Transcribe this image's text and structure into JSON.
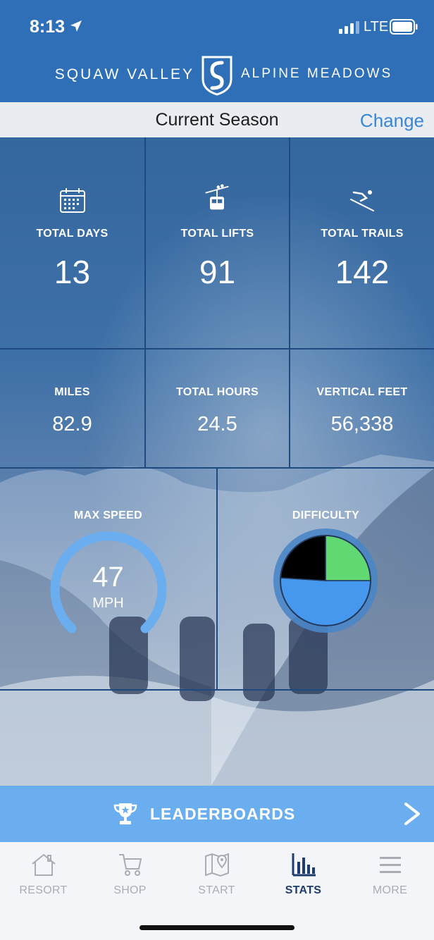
{
  "status_bar": {
    "time": "8:13",
    "network": "LTE"
  },
  "brand": {
    "left": "SQUAW VALLEY",
    "right": "ALPINE MEADOWS"
  },
  "season": {
    "title": "Current Season",
    "change_label": "Change"
  },
  "stats": {
    "total_days": {
      "label": "TOTAL DAYS",
      "value": "13",
      "icon": "calendar-icon"
    },
    "total_lifts": {
      "label": "TOTAL LIFTS",
      "value": "91",
      "icon": "gondola-icon"
    },
    "total_trails": {
      "label": "TOTAL TRAILS",
      "value": "142",
      "icon": "skier-icon"
    },
    "miles": {
      "label": "MILES",
      "value": "82.9"
    },
    "total_hours": {
      "label": "TOTAL HOURS",
      "value": "24.5"
    },
    "vertical_feet": {
      "label": "VERTICAL FEET",
      "value": "56,338"
    },
    "max_speed": {
      "label": "MAX SPEED",
      "value": "47",
      "unit": "MPH"
    },
    "difficulty": {
      "label": "DIFFICULTY"
    }
  },
  "chart_data": {
    "type": "pie",
    "title": "DIFFICULTY",
    "slices": [
      {
        "value": 25,
        "color": "#62d873"
      },
      {
        "value": 51,
        "color": "#4697ee"
      },
      {
        "value": 24,
        "color": "#000000"
      }
    ]
  },
  "leaderboards": {
    "label": "LEADERBOARDS"
  },
  "tabs": [
    {
      "label": "RESORT",
      "icon": "home-icon",
      "active": false
    },
    {
      "label": "SHOP",
      "icon": "cart-icon",
      "active": false
    },
    {
      "label": "START",
      "icon": "map-pin-icon",
      "active": false
    },
    {
      "label": "STATS",
      "icon": "bar-chart-icon",
      "active": true
    },
    {
      "label": "MORE",
      "icon": "menu-icon",
      "active": false
    }
  ],
  "colors": {
    "header": "#2f6fb8",
    "accent": "#3a86d6",
    "leaderboard": "#6aaef0",
    "active_tab": "#1e3d6e",
    "inactive_tab": "#a9adb3"
  }
}
